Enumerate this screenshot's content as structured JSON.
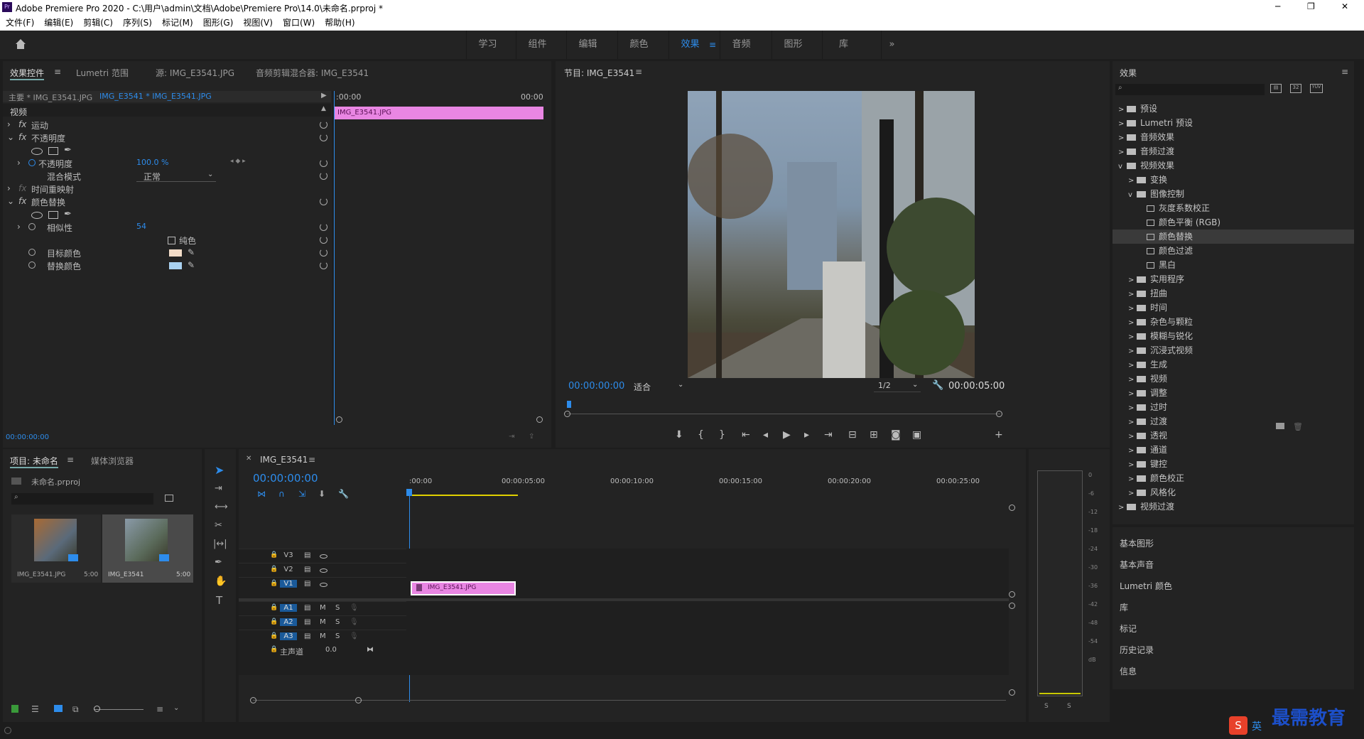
{
  "title_bar": {
    "app_icon": "Pr",
    "title": "Adobe Premiere Pro 2020 - C:\\用户\\admin\\文档\\Adobe\\Premiere Pro\\14.0\\未命名.prproj *",
    "minimize": "─",
    "maximize": "❐",
    "close": "✕"
  },
  "menu": [
    "文件(F)",
    "编辑(E)",
    "剪辑(C)",
    "序列(S)",
    "标记(M)",
    "图形(G)",
    "视图(V)",
    "窗口(W)",
    "帮助(H)"
  ],
  "workspaces": {
    "home_icon": "home-icon",
    "items": [
      "学习",
      "组件",
      "编辑",
      "颜色",
      "效果",
      "音频",
      "图形",
      "库"
    ],
    "active": "效果",
    "more": "»"
  },
  "effect_controls": {
    "tabs": [
      "效果控件",
      "Lumetri 范围",
      "源: IMG_E3541.JPG",
      "音频剪辑混合器: IMG_E3541"
    ],
    "master_label": "主要 * IMG_E3541.JPG",
    "clip_select": "IMG_E3541 * IMG_E3541.JPG",
    "tl_start": ":00:00",
    "tl_end": "00:00",
    "clip_bar": "IMG_E3541.JPG",
    "section": "视频",
    "fx": {
      "motion": "运动",
      "opacity": "不透明度",
      "opacity_param": "不透明度",
      "opacity_value": "100.0 %",
      "blend_mode": "混合模式",
      "blend_value": "正常",
      "time_remap": "时间重映射",
      "color_replace": "颜色替换",
      "similarity": "相似性",
      "similarity_value": "54",
      "solid": "纯色",
      "target_color": "目标颜色",
      "replace_color": "替换颜色",
      "fx_badge": "fx"
    },
    "target_color_swatch": "#f2dcc8",
    "replace_color_swatch": "#a9d1f0",
    "timecode": "00:00:00:00"
  },
  "program": {
    "title": "节目: IMG_E3541",
    "timecode": "00:00:00:00",
    "fit": "适合",
    "quality": "1/2",
    "duration": "00:00:05:00"
  },
  "project": {
    "tabs": [
      "项目: 未命名",
      "媒体浏览器"
    ],
    "file": "未命名.prproj",
    "items": [
      {
        "name": "IMG_E3541.JPG",
        "dur": "5:00"
      },
      {
        "name": "IMG_E3541",
        "dur": "5:00"
      }
    ]
  },
  "timeline": {
    "tab": "IMG_E3541",
    "timecode": "00:00:00:00",
    "ruler": [
      ":00:00",
      "00:00:05:00",
      "00:00:10:00",
      "00:00:15:00",
      "00:00:20:00",
      "00:00:25:00"
    ],
    "video_tracks": [
      "V3",
      "V2",
      "V1"
    ],
    "audio_tracks": [
      "A1",
      "A2",
      "A3"
    ],
    "master": "主声道",
    "master_val": "0.0",
    "clip": "IMG_E3541.JPG",
    "m": "M",
    "s": "S"
  },
  "audio_meter": {
    "labels": [
      "0",
      "-6",
      "-12",
      "-18",
      "-24",
      "-30",
      "-36",
      "-42",
      "-48",
      "-54",
      "dB"
    ],
    "solo": [
      "S",
      "S"
    ]
  },
  "effects": {
    "title": "效果",
    "tree": [
      {
        "label": "预设",
        "lvl": 0,
        "type": "folder",
        "arrow": ">"
      },
      {
        "label": "Lumetri 预设",
        "lvl": 0,
        "type": "folder",
        "arrow": ">"
      },
      {
        "label": "音频效果",
        "lvl": 0,
        "type": "folder",
        "arrow": ">"
      },
      {
        "label": "音频过渡",
        "lvl": 0,
        "type": "folder",
        "arrow": ">"
      },
      {
        "label": "视频效果",
        "lvl": 0,
        "type": "folder",
        "arrow": "v"
      },
      {
        "label": "变换",
        "lvl": 1,
        "type": "folder",
        "arrow": ">"
      },
      {
        "label": "图像控制",
        "lvl": 1,
        "type": "folder",
        "arrow": "v"
      },
      {
        "label": "灰度系数校正",
        "lvl": 2,
        "type": "fx",
        "arrow": ""
      },
      {
        "label": "颜色平衡 (RGB)",
        "lvl": 2,
        "type": "fx",
        "arrow": ""
      },
      {
        "label": "颜色替换",
        "lvl": 2,
        "type": "fx",
        "arrow": "",
        "selected": true
      },
      {
        "label": "颜色过滤",
        "lvl": 2,
        "type": "fx",
        "arrow": ""
      },
      {
        "label": "黑白",
        "lvl": 2,
        "type": "fx",
        "arrow": ""
      },
      {
        "label": "实用程序",
        "lvl": 1,
        "type": "folder",
        "arrow": ">"
      },
      {
        "label": "扭曲",
        "lvl": 1,
        "type": "folder",
        "arrow": ">"
      },
      {
        "label": "时间",
        "lvl": 1,
        "type": "folder",
        "arrow": ">"
      },
      {
        "label": "杂色与颗粒",
        "lvl": 1,
        "type": "folder",
        "arrow": ">"
      },
      {
        "label": "模糊与锐化",
        "lvl": 1,
        "type": "folder",
        "arrow": ">"
      },
      {
        "label": "沉浸式视频",
        "lvl": 1,
        "type": "folder",
        "arrow": ">"
      },
      {
        "label": "生成",
        "lvl": 1,
        "type": "folder",
        "arrow": ">"
      },
      {
        "label": "视频",
        "lvl": 1,
        "type": "folder",
        "arrow": ">"
      },
      {
        "label": "调整",
        "lvl": 1,
        "type": "folder",
        "arrow": ">"
      },
      {
        "label": "过时",
        "lvl": 1,
        "type": "folder",
        "arrow": ">"
      },
      {
        "label": "过渡",
        "lvl": 1,
        "type": "folder",
        "arrow": ">"
      },
      {
        "label": "透视",
        "lvl": 1,
        "type": "folder",
        "arrow": ">"
      },
      {
        "label": "通道",
        "lvl": 1,
        "type": "folder",
        "arrow": ">"
      },
      {
        "label": "键控",
        "lvl": 1,
        "type": "folder",
        "arrow": ">"
      },
      {
        "label": "颜色校正",
        "lvl": 1,
        "type": "folder",
        "arrow": ">"
      },
      {
        "label": "风格化",
        "lvl": 1,
        "type": "folder",
        "arrow": ">"
      },
      {
        "label": "视频过渡",
        "lvl": 0,
        "type": "folder",
        "arrow": ">"
      }
    ],
    "panels": [
      "基本图形",
      "基本声音",
      "Lumetri 颜色",
      "库",
      "标记",
      "历史记录",
      "信息"
    ],
    "new_bin_icons": [
      "32",
      "YUV"
    ]
  },
  "watermark": {
    "text": "最需教育",
    "ime": "英"
  }
}
